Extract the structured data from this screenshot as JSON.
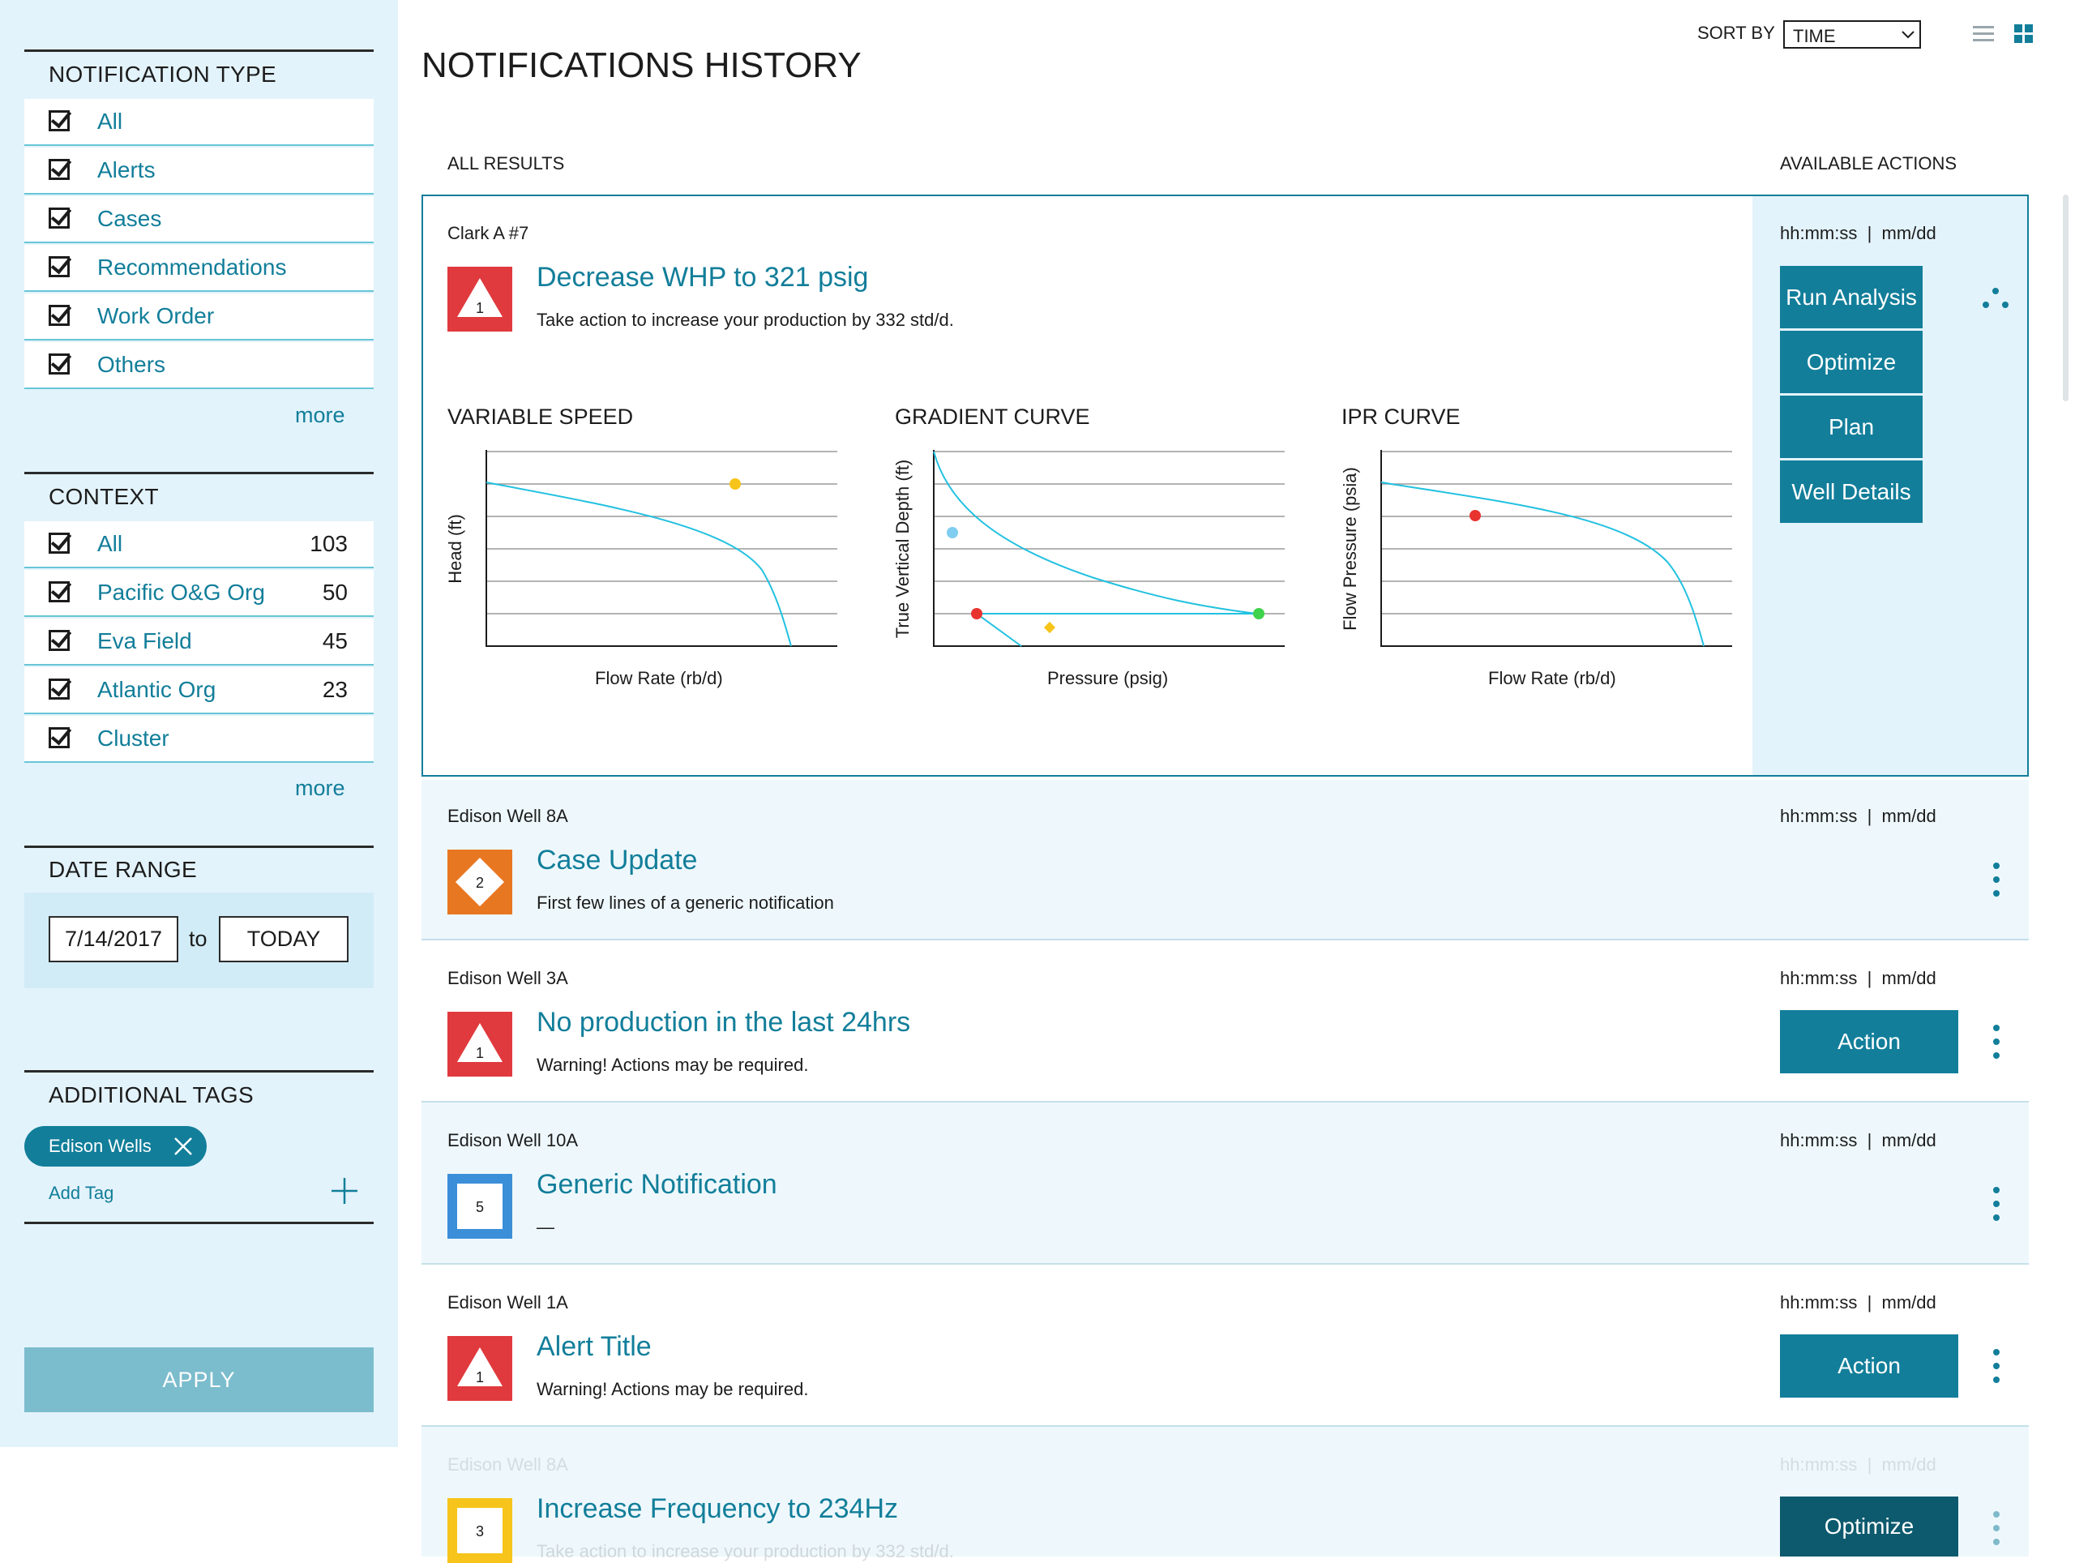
{
  "sidebar": {
    "notification_type": {
      "title": "NOTIFICATION TYPE",
      "items": [
        {
          "label": "All"
        },
        {
          "label": "Alerts"
        },
        {
          "label": "Cases"
        },
        {
          "label": "Recommendations"
        },
        {
          "label": "Work Order"
        },
        {
          "label": "Others"
        }
      ],
      "more": "more"
    },
    "context": {
      "title": "CONTEXT",
      "items": [
        {
          "label": "All",
          "count": "103"
        },
        {
          "label": "Pacific O&G Org",
          "count": "50"
        },
        {
          "label": "Eva Field",
          "count": "45"
        },
        {
          "label": "Atlantic Org",
          "count": "23"
        },
        {
          "label": "Cluster",
          "count": ""
        }
      ],
      "more": "more"
    },
    "date_range": {
      "title": "DATE RANGE",
      "from": "7/14/2017",
      "to_label": "to",
      "to": "TODAY"
    },
    "tags": {
      "title": "ADDITIONAL TAGS",
      "chips": [
        "Edison Wells"
      ],
      "add_label": "Add Tag"
    },
    "apply_label": "APPLY"
  },
  "header": {
    "title": "NOTIFICATIONS HISTORY",
    "sort_label": "SORT BY",
    "sort_value": "TIME"
  },
  "list": {
    "all_results": "ALL RESULTS",
    "available_actions": "AVAILABLE ACTIONS"
  },
  "expanded": {
    "well": "Clark A #7",
    "time": "hh:mm:ss  |  mm/dd",
    "priority": "1",
    "title": "Decrease WHP to 321 psig",
    "desc": "Take action to increase your production by 332 std/d.",
    "actions": [
      "Run Analysis",
      "Optimize",
      "Plan",
      "Well Details"
    ]
  },
  "charts": [
    {
      "title": "VARIABLE SPEED",
      "xlabel": "Flow Rate (rb/d)",
      "ylabel": "Head (ft)"
    },
    {
      "title": "GRADIENT CURVE",
      "xlabel": "Pressure (psig)",
      "ylabel": "True Vertical Depth (ft)"
    },
    {
      "title": "IPR CURVE",
      "xlabel": "Flow Rate (rb/d)",
      "ylabel": "Flow Pressure (psia)"
    }
  ],
  "rows": [
    {
      "well": "Edison Well 8A",
      "time": "hh:mm:ss  |  mm/dd",
      "priority": "2",
      "title": "Case Update",
      "desc": "First few lines of a generic notification",
      "action": ""
    },
    {
      "well": "Edison Well 3A",
      "time": "hh:mm:ss  |  mm/dd",
      "priority": "1",
      "title": "No production in the last 24hrs",
      "desc": "Warning! Actions may be required.",
      "action": "Action"
    },
    {
      "well": "Edison Well 10A",
      "time": "hh:mm:ss  |  mm/dd",
      "priority": "5",
      "title": "Generic Notification",
      "desc": "—",
      "action": ""
    },
    {
      "well": "Edison Well 1A",
      "time": "hh:mm:ss  |  mm/dd",
      "priority": "1",
      "title": "Alert Title",
      "desc": "Warning! Actions may be required.",
      "action": "Action"
    },
    {
      "well": "Edison Well 8A",
      "time": "hh:mm:ss  |  mm/dd",
      "priority": "3",
      "title": "Increase Frequency to 234Hz",
      "desc": "Take action to increase your production by 332 std/d.",
      "action": "Optimize"
    }
  ],
  "colors": {
    "accent": "#127e9a",
    "sidebar_bg": "#e3f3fb",
    "critical": "#e03a3e",
    "case": "#e87722",
    "info": "#3b8fd9",
    "warning": "#f6c41a"
  }
}
